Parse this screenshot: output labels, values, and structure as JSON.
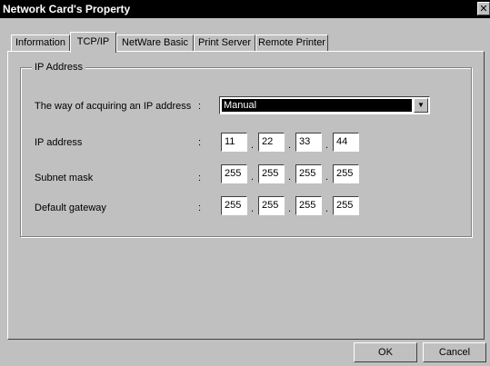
{
  "window": {
    "title": "Network Card's Property",
    "close_glyph": "✕"
  },
  "tabs": [
    {
      "label": "Information",
      "active": false
    },
    {
      "label": "TCP/IP",
      "active": true
    },
    {
      "label": "NetWare Basic",
      "active": false
    },
    {
      "label": "Print Server",
      "active": false
    },
    {
      "label": "Remote Printer",
      "active": false
    }
  ],
  "group": {
    "label": "IP Address",
    "acquire_label": "The way of acquiring an IP address",
    "acquire_value": "Manual",
    "colon": ":",
    "dot": ".",
    "ip_label": "IP address",
    "ip": [
      "11",
      "22",
      "33",
      "44"
    ],
    "subnet_label": "Subnet mask",
    "subnet": [
      "255",
      "255",
      "255",
      "255"
    ],
    "gateway_label": "Default gateway",
    "gateway": [
      "255",
      "255",
      "255",
      "255"
    ]
  },
  "buttons": {
    "ok": "OK",
    "cancel": "Cancel"
  },
  "icons": {
    "dropdown": "chevron-down-icon",
    "close": "close-icon"
  }
}
